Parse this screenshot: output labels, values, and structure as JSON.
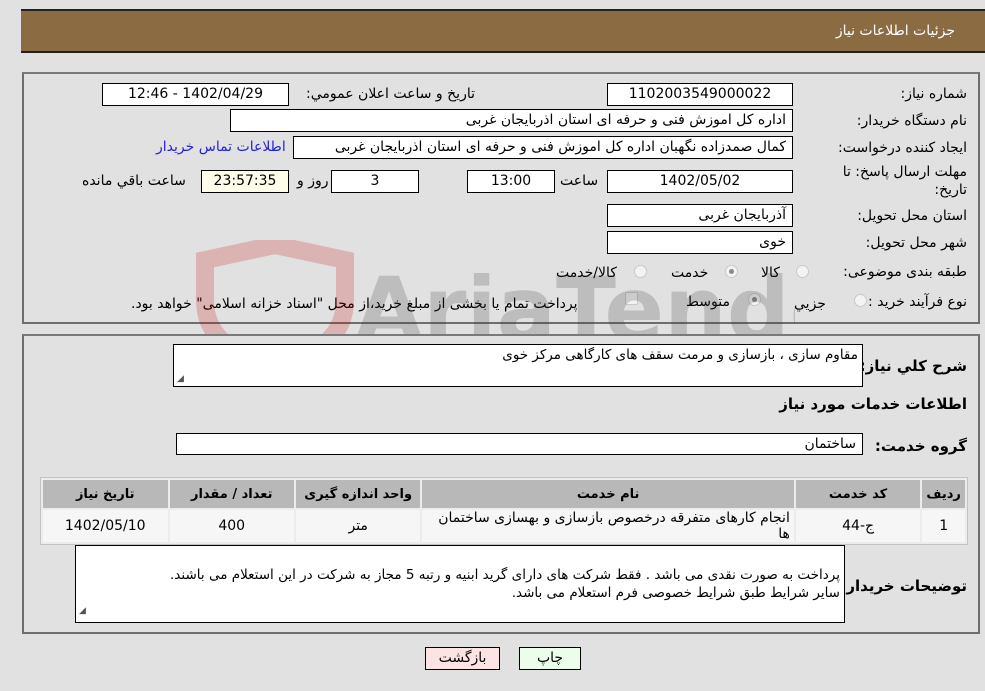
{
  "header": {
    "title": "جزئیات اطلاعات نیاز"
  },
  "details": {
    "need_number": {
      "label": "شماره نیاز:",
      "value": "1102003549000022"
    },
    "announce_datetime": {
      "label": "تاریخ و ساعت اعلان عمومي:",
      "value": "1402/04/29 - 12:46"
    },
    "buyer_org": {
      "label": "نام دستگاه خریدار:",
      "value": "اداره کل اموزش فنی و حرفه ای استان اذربایجان غربی"
    },
    "requester": {
      "label": "ایجاد کننده درخواست:",
      "value": "کمال صمدزاده نگهبان اداره کل اموزش فنی و حرفه ای استان اذربایجان غربی"
    },
    "buyer_contact_link": "اطلاعات تماس خریدار",
    "deadline": {
      "label": "مهلت ارسال پاسخ: تا تاریخ:",
      "date": "1402/05/02",
      "time_label": "ساعت",
      "time": "13:00",
      "days": "3",
      "days_label": "روز و",
      "remaining": "23:57:35",
      "remaining_label": "ساعت باقي مانده"
    },
    "delivery_province": {
      "label": "استان محل تحویل:",
      "value": "آذربایجان غربی"
    },
    "delivery_city": {
      "label": "شهر محل تحویل:",
      "value": "خوی"
    },
    "category": {
      "label": "طبقه بندی موضوعی:",
      "options": [
        "کالا",
        "خدمت",
        "کالا/خدمت"
      ],
      "selected": "خدمت"
    },
    "purchase_type": {
      "label": "نوع فرآیند خرید :",
      "options": [
        "جزيي",
        "متوسط"
      ],
      "selected": "متوسط",
      "treasury_checkbox_label": "پرداخت تمام یا بخشی از مبلغ خرید،از محل \"اسناد خزانه اسلامی\" خواهد بود.",
      "treasury_checked": false
    }
  },
  "summary": {
    "description_label": "شرح کلي نیاز:",
    "description": "مقاوم سازی ، بازسازی و مرمت سقف های کارگاهی مرکز خوی",
    "services_heading": "اطلاعات خدمات مورد نیاز",
    "service_group_label": "گروه خدمت:",
    "service_group": "ساختمان"
  },
  "table": {
    "headers": [
      "ردیف",
      "کد خدمت",
      "نام خدمت",
      "واحد اندازه گیری",
      "تعداد / مقدار",
      "تاریخ نیاز"
    ],
    "rows": [
      [
        "1",
        "ج-44",
        "انجام کارهای متفرقه درخصوص بازسازی و بهسازی ساختمان ها",
        "متر",
        "400",
        "1402/05/10"
      ]
    ]
  },
  "buyer_notes": {
    "label": "توضیحات خریدار:",
    "text": "پرداخت به صورت نقدی می باشد . فقط شرکت های دارای گرید ابنیه و رتبه 5 مجاز به شرکت در این استعلام می باشند.\nسایر شرایط طبق شرایط خصوصی فرم استعلام می باشد."
  },
  "buttons": {
    "print": "چاپ",
    "back": "بازگشت"
  },
  "watermark": "AriaTender.neT"
}
